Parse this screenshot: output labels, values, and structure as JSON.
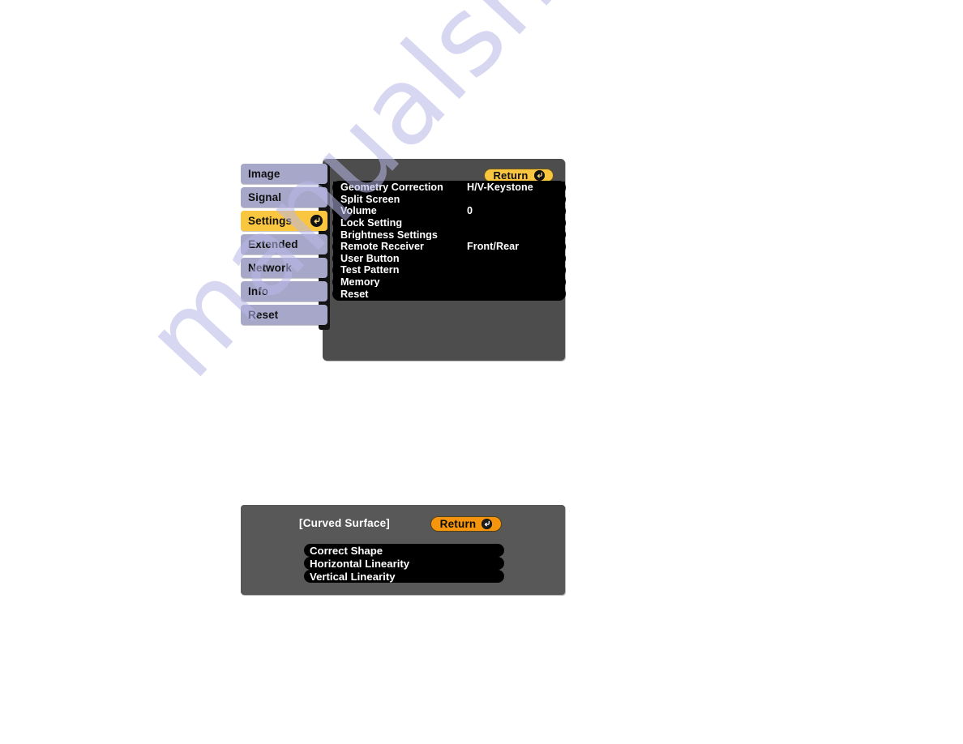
{
  "watermark": {
    "text": "manualshive.com"
  },
  "colors": {
    "panel_bg": "#4d4d4d",
    "panel2_bg": "#585858",
    "tab_bg": "#a7a7ca",
    "tab_selected_bg": "#fbc63f",
    "return_top_bg": "#fbc63f",
    "return_bottom_bg": "#f5950d",
    "row_bg": "#000000",
    "row_text": "#ffffff"
  },
  "main_menu": {
    "return_button": {
      "label": "Return",
      "icon": "enter-icon"
    },
    "tabs": [
      {
        "label": "Image",
        "selected": false
      },
      {
        "label": "Signal",
        "selected": false
      },
      {
        "label": "Settings",
        "selected": true
      },
      {
        "label": "Extended",
        "selected": false
      },
      {
        "label": "Network",
        "selected": false
      },
      {
        "label": "Info",
        "selected": false
      },
      {
        "label": "Reset",
        "selected": false
      }
    ],
    "rows": [
      {
        "label": "Geometry Correction",
        "value": "H/V-Keystone"
      },
      {
        "label": "Split Screen",
        "value": ""
      },
      {
        "label": "Volume",
        "value": "0"
      },
      {
        "label": "Lock Setting",
        "value": ""
      },
      {
        "label": "Brightness Settings",
        "value": ""
      },
      {
        "label": "Remote Receiver",
        "value": "Front/Rear"
      },
      {
        "label": "User Button",
        "value": ""
      },
      {
        "label": "Test Pattern",
        "value": ""
      },
      {
        "label": "Memory",
        "value": ""
      },
      {
        "label": "Reset",
        "value": ""
      }
    ]
  },
  "curved_surface_menu": {
    "title": "[Curved Surface]",
    "return_button": {
      "label": "Return",
      "icon": "enter-icon"
    },
    "rows": [
      {
        "label": "Correct Shape"
      },
      {
        "label": "Horizontal Linearity"
      },
      {
        "label": "Vertical Linearity"
      }
    ]
  }
}
